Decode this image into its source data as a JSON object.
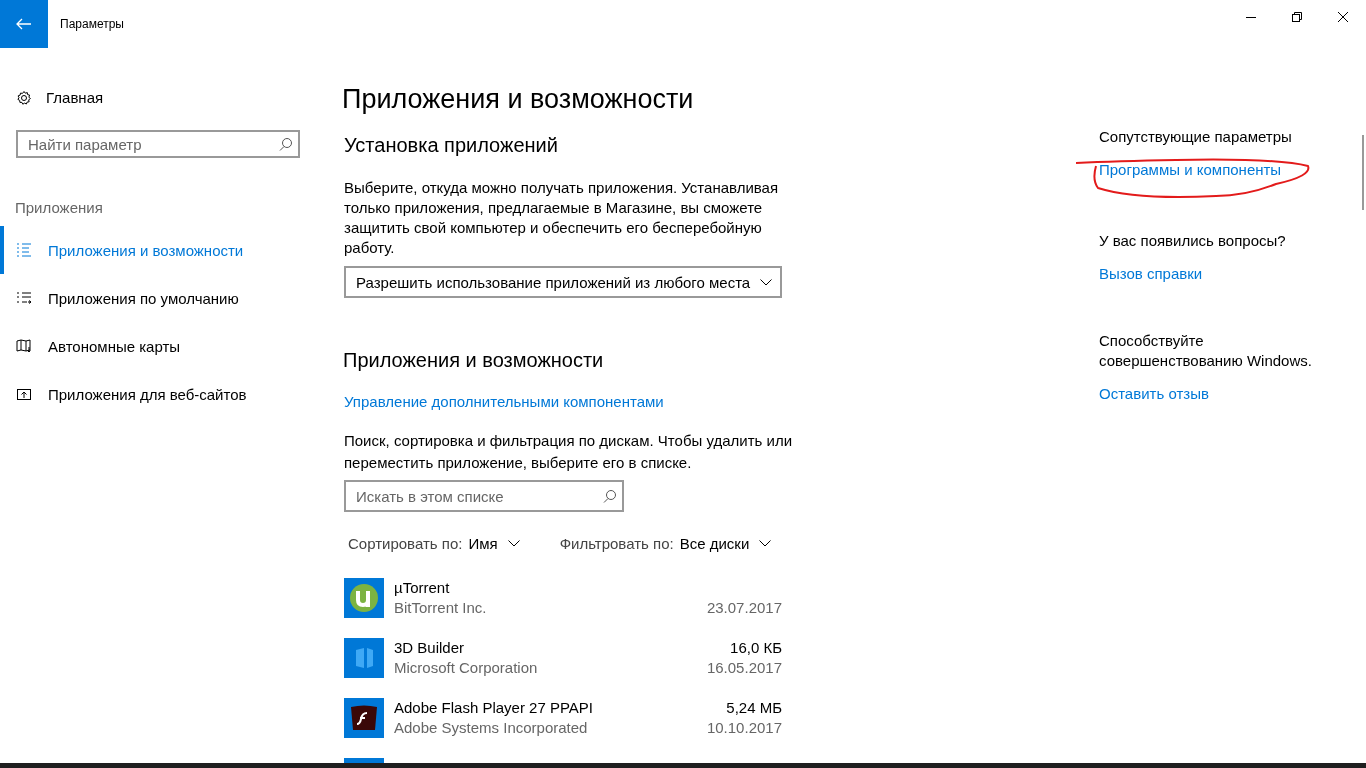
{
  "window": {
    "title": "Параметры"
  },
  "sidebar": {
    "home": "Главная",
    "search": {
      "placeholder": "Найти параметр"
    },
    "section": "Приложения",
    "items": [
      {
        "label": "Приложения и возможности",
        "selected": true
      },
      {
        "label": "Приложения по умолчанию",
        "selected": false
      },
      {
        "label": "Автономные карты",
        "selected": false
      },
      {
        "label": "Приложения для веб-сайтов",
        "selected": false
      }
    ]
  },
  "main": {
    "title": "Приложения и возможности",
    "install": {
      "heading": "Установка приложений",
      "text": "Выберите, откуда можно получать приложения. Устанавливая только приложения, предлагаемые в Магазине, вы сможете защитить свой компьютер и обеспечить его бесперебойную работу.",
      "dropdown": "Разрешить использование приложений из любого места"
    },
    "apps": {
      "heading": "Приложения и возможности",
      "link": "Управление дополнительными компонентами",
      "text": "Поиск, сортировка и фильтрация по дискам. Чтобы удалить или переместить приложение, выберите его в списке.",
      "search": {
        "placeholder": "Искать в этом списке"
      },
      "sort": {
        "label": "Сортировать по:",
        "value": "Имя"
      },
      "filter": {
        "label": "Фильтровать по:",
        "value": "Все диски"
      },
      "rows": [
        {
          "name": "µTorrent",
          "publisher": "BitTorrent Inc.",
          "date": "23.07.2017"
        },
        {
          "name": "3D Builder",
          "publisher": "Microsoft Corporation",
          "size": "16,0 КБ",
          "date": "16.05.2017"
        },
        {
          "name": "Adobe Flash Player 27 PPAPI",
          "publisher": "Adobe Systems Incorporated",
          "size": "5,24 МБ",
          "date": "10.10.2017"
        }
      ]
    }
  },
  "related": [
    {
      "heading": "Сопутствующие параметры",
      "link": "Программы и компоненты"
    },
    {
      "heading": "У вас появились вопросы?",
      "link": "Вызов справки"
    },
    {
      "heading": "Способствуйте совершенствованию Windows.",
      "link": "Оставить отзыв"
    }
  ]
}
